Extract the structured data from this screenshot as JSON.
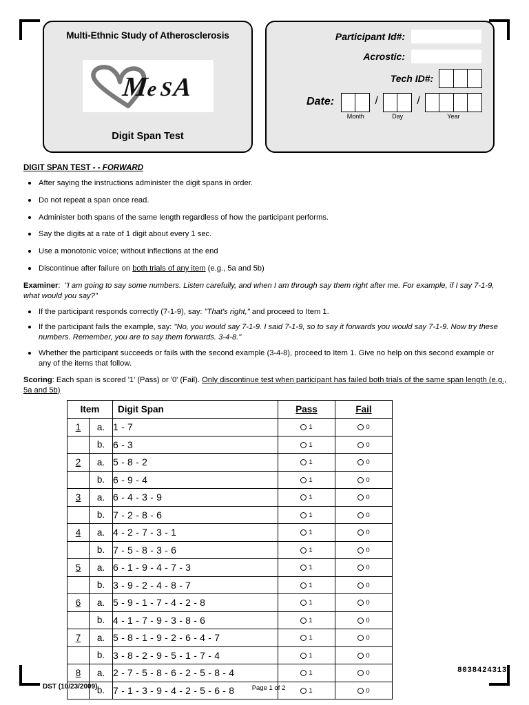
{
  "document": {
    "study_title": "Multi-Ethnic Study of Atherosclerosis",
    "logo_text": "MeSA",
    "form_title": "Digit Span Test"
  },
  "id_panel": {
    "participant_label": "Participant Id#:",
    "participant_value": "",
    "acrostic_label": "Acrostic:",
    "acrostic_value": "",
    "tech_label": "Tech ID#:",
    "tech_boxes": 3,
    "date_label": "Date:",
    "month_caption": "Month",
    "day_caption": "Day",
    "year_caption": "Year",
    "month_boxes": 2,
    "day_boxes": 2,
    "year_boxes": 4,
    "separator": "/"
  },
  "section": {
    "heading_main": "DIGIT SPAN TEST - - ",
    "heading_emph": "FORWARD"
  },
  "instructions": [
    "After saying the instructions administer  the digit spans in order.",
    "Do not repeat a span once read.",
    "Administer both spans of the same length regardless of how the participant performs.",
    "Say the digits at a rate of 1 digit about every 1 sec.",
    "Use a monotonic voice; without inflections at the end"
  ],
  "instruction_last": {
    "pre": "Discontinue after failure on ",
    "underlined": "both trials of any item",
    "post": " (e.g., 5a and 5b)"
  },
  "examiner": {
    "label": "Examiner",
    "colon": ":",
    "quote": "\"I am going to say some numbers.  Listen carefully, and when I am through say them right after me.  For example, if I say 7-1-9, what would you say?\""
  },
  "examiner_bullets": {
    "b1_pre": "If the participant responds correctly (7-1-9), say: ",
    "b1_quote": "\"That's right,\"",
    "b1_post": " and proceed to Item 1.",
    "b2_pre": "If the participant fails the example, say: ",
    "b2_quote": "\"No, you would say 7-1-9.  I said 7-1-9, so to say it forwards you would say 7-1-9.  Now try these numbers.  Remember, you are to say them forwards. 3-4-8.\"",
    "b3": "Whether the participant succeeds or fails with the second example (3-4-8), proceed to Item 1.  Give no help on this second example or any of the items that follow."
  },
  "scoring": {
    "label": "Scoring",
    "colon": ":",
    "text_plain": "  Each span is scored '1' (Pass) or '0' (Fail).  ",
    "text_underlined": "Only discontinue test when participant has failed both trials of the same span length (e.g., 5a and 5b)"
  },
  "table": {
    "headers": {
      "item": "Item",
      "span": "Digit Span",
      "pass": "Pass",
      "fail": "Fail"
    },
    "pass_value": "1",
    "fail_value": "0",
    "rows": [
      {
        "item": "1",
        "sub": "a.",
        "span": "1 - 7"
      },
      {
        "item": "",
        "sub": "b.",
        "span": "6 - 3"
      },
      {
        "item": "2",
        "sub": "a.",
        "span": "5 - 8 - 2"
      },
      {
        "item": "",
        "sub": "b.",
        "span": "6 - 9 - 4"
      },
      {
        "item": "3",
        "sub": "a.",
        "span": "6 - 4 - 3 - 9"
      },
      {
        "item": "",
        "sub": "b.",
        "span": "7 - 2 - 8 - 6"
      },
      {
        "item": "4",
        "sub": "a.",
        "span": "4 - 2 - 7 - 3 - 1"
      },
      {
        "item": "",
        "sub": "b.",
        "span": "7 - 5 - 8 - 3 - 6"
      },
      {
        "item": "5",
        "sub": "a.",
        "span": "6 - 1 - 9 - 4 - 7 - 3"
      },
      {
        "item": "",
        "sub": "b.",
        "span": "3 - 9 - 2 - 4 - 8 - 7"
      },
      {
        "item": "6",
        "sub": "a.",
        "span": "5 - 9 - 1 - 7 - 4 - 2 - 8"
      },
      {
        "item": "",
        "sub": "b.",
        "span": "4 - 1 - 7 - 9 - 3 - 8 - 6"
      },
      {
        "item": "7",
        "sub": "a.",
        "span": "5 - 8 - 1 - 9 - 2 - 6 - 4 - 7"
      },
      {
        "item": "",
        "sub": "b.",
        "span": "3 - 8 - 2 - 9 - 5 - 1 - 7 - 4"
      },
      {
        "item": "8",
        "sub": "a.",
        "span": "2 - 7 - 5 - 8 - 6 - 2 - 5 - 8 - 4"
      },
      {
        "item": "",
        "sub": "b.",
        "span": "7 - 1 - 3 - 9 - 4 - 2 - 5 - 6 - 8"
      }
    ]
  },
  "footer": {
    "form_code": "DST  (10/23/2009)",
    "page": "Page 1 of 2",
    "barcode_number": "8038424313"
  }
}
